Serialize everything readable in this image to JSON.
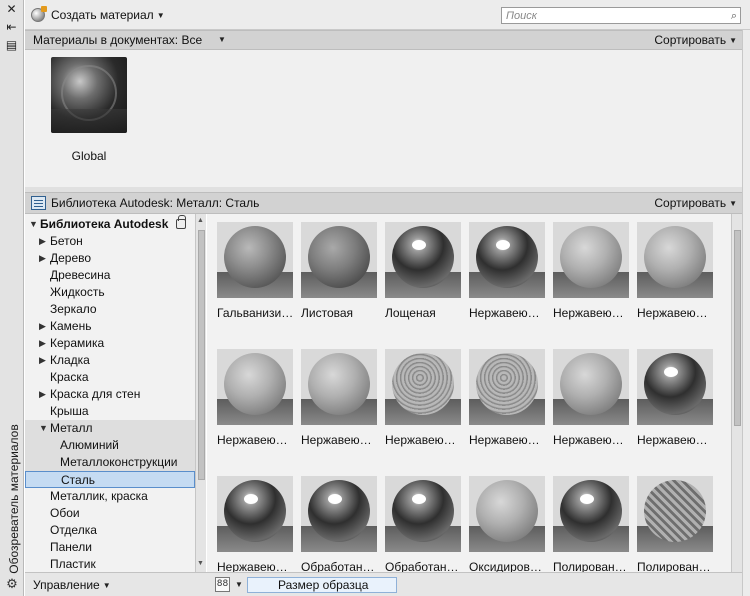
{
  "side_panel": {
    "title": "Обозреватель материалов"
  },
  "toolbar": {
    "create_label": "Создать материал",
    "search_placeholder": "Поиск"
  },
  "document_materials": {
    "filter_label": "Материалы в документах: Все",
    "sort_label": "Сортировать",
    "items": [
      {
        "name": "Global"
      }
    ]
  },
  "library": {
    "header_label": "Библиотека Autodesk: Металл: Сталь",
    "sort_label": "Сортировать",
    "tree": [
      {
        "label": "Библиотека Autodesk",
        "level": 0,
        "expanded": true,
        "locked": true
      },
      {
        "label": "Бетон",
        "level": 1,
        "collapsed": true
      },
      {
        "label": "Дерево",
        "level": 1,
        "collapsed": true
      },
      {
        "label": "Древесина",
        "level": 1
      },
      {
        "label": "Жидкость",
        "level": 1
      },
      {
        "label": "Зеркало",
        "level": 1
      },
      {
        "label": "Камень",
        "level": 1,
        "collapsed": true
      },
      {
        "label": "Керамика",
        "level": 1,
        "collapsed": true
      },
      {
        "label": "Кладка",
        "level": 1,
        "collapsed": true
      },
      {
        "label": "Краска",
        "level": 1
      },
      {
        "label": "Краска для стен",
        "level": 1,
        "collapsed": true
      },
      {
        "label": "Крыша",
        "level": 1
      },
      {
        "label": "Металл",
        "level": 1,
        "expanded": true
      },
      {
        "label": "Алюминий",
        "level": 2
      },
      {
        "label": "Металлоконструкции",
        "level": 2
      },
      {
        "label": "Сталь",
        "level": 2,
        "selected": true
      },
      {
        "label": "Металлик, краска",
        "level": 1
      },
      {
        "label": "Обои",
        "level": 1
      },
      {
        "label": "Отделка",
        "level": 1
      },
      {
        "label": "Панели",
        "level": 1
      },
      {
        "label": "Пластик",
        "level": 1
      }
    ],
    "swatches": [
      {
        "label": "Гальванизи…",
        "style": "matte"
      },
      {
        "label": "Листовая",
        "style": "rough"
      },
      {
        "label": "Лощеная",
        "style": "shiny"
      },
      {
        "label": "Нержавею…",
        "style": "shiny"
      },
      {
        "label": "Нержавею…",
        "style": "light"
      },
      {
        "label": "Нержавею…",
        "style": "light"
      },
      {
        "label": "Нержавею…",
        "style": "light"
      },
      {
        "label": "Нержавею…",
        "style": "light"
      },
      {
        "label": "Нержавею…",
        "style": "pattern"
      },
      {
        "label": "Нержавею…",
        "style": "pattern"
      },
      {
        "label": "Нержавею…",
        "style": "light"
      },
      {
        "label": "Нержавею…",
        "style": "shiny"
      },
      {
        "label": "Нержавею…",
        "style": "shiny"
      },
      {
        "label": "Обработан…",
        "style": "shiny"
      },
      {
        "label": "Обработан…",
        "style": "shiny"
      },
      {
        "label": "Оксидиров…",
        "style": "light"
      },
      {
        "label": "Полирован…",
        "style": "shiny"
      },
      {
        "label": "Полирован…",
        "style": "diamond"
      }
    ]
  },
  "bottom_bar": {
    "manage_label": "Управление",
    "view_icon": "grid-view-icon",
    "size_label": "Размер образца"
  },
  "colors": {
    "selection_bg": "#c5dbf2",
    "selection_border": "#5a8ecb",
    "header_bg": "#d2d2d2"
  }
}
